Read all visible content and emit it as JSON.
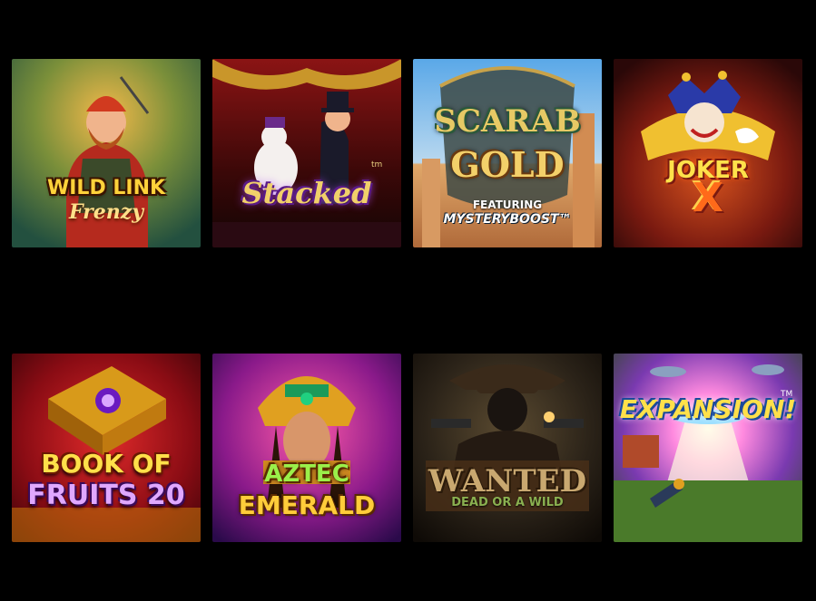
{
  "games": [
    {
      "title_line1": "WILD LINK",
      "title_line2": "Frenzy"
    },
    {
      "title_line1": "Stacked",
      "title_line2": "tm"
    },
    {
      "title_line1": "SCARAB",
      "title_line2": "GOLD",
      "subtitle_1": "FEATURING",
      "subtitle_2": "MYSTERYBOOST™"
    },
    {
      "title_line1": "JOKER",
      "title_line2": "X"
    },
    {
      "title_line1": "BOOK OF",
      "title_line2": "FRUITS 20"
    },
    {
      "title_line1": "AZTEC",
      "title_line2": "EMERALD"
    },
    {
      "title_line1": "WANTED",
      "title_line2": "DEAD OR A WILD"
    },
    {
      "title_line1": "EXPANSION!",
      "title_line2": "TM"
    }
  ]
}
